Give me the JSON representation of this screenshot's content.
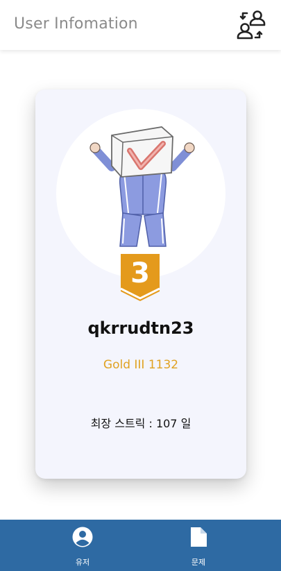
{
  "header": {
    "title": "User Infomation",
    "action_icon": "switch-user-icon"
  },
  "profile": {
    "username": "qkrrudtn23",
    "tier": "Gold III 1132",
    "tier_level": "3",
    "streak": "최장 스트릭 : 107 일"
  },
  "bottom_nav": {
    "items": [
      {
        "label": "유저",
        "icon": "user-circle-icon"
      },
      {
        "label": "문제",
        "icon": "document-icon"
      }
    ]
  },
  "colors": {
    "tier_gold": "#e0a221",
    "nav_background": "#2e6aa3",
    "card_background": "#f4f5fd"
  }
}
